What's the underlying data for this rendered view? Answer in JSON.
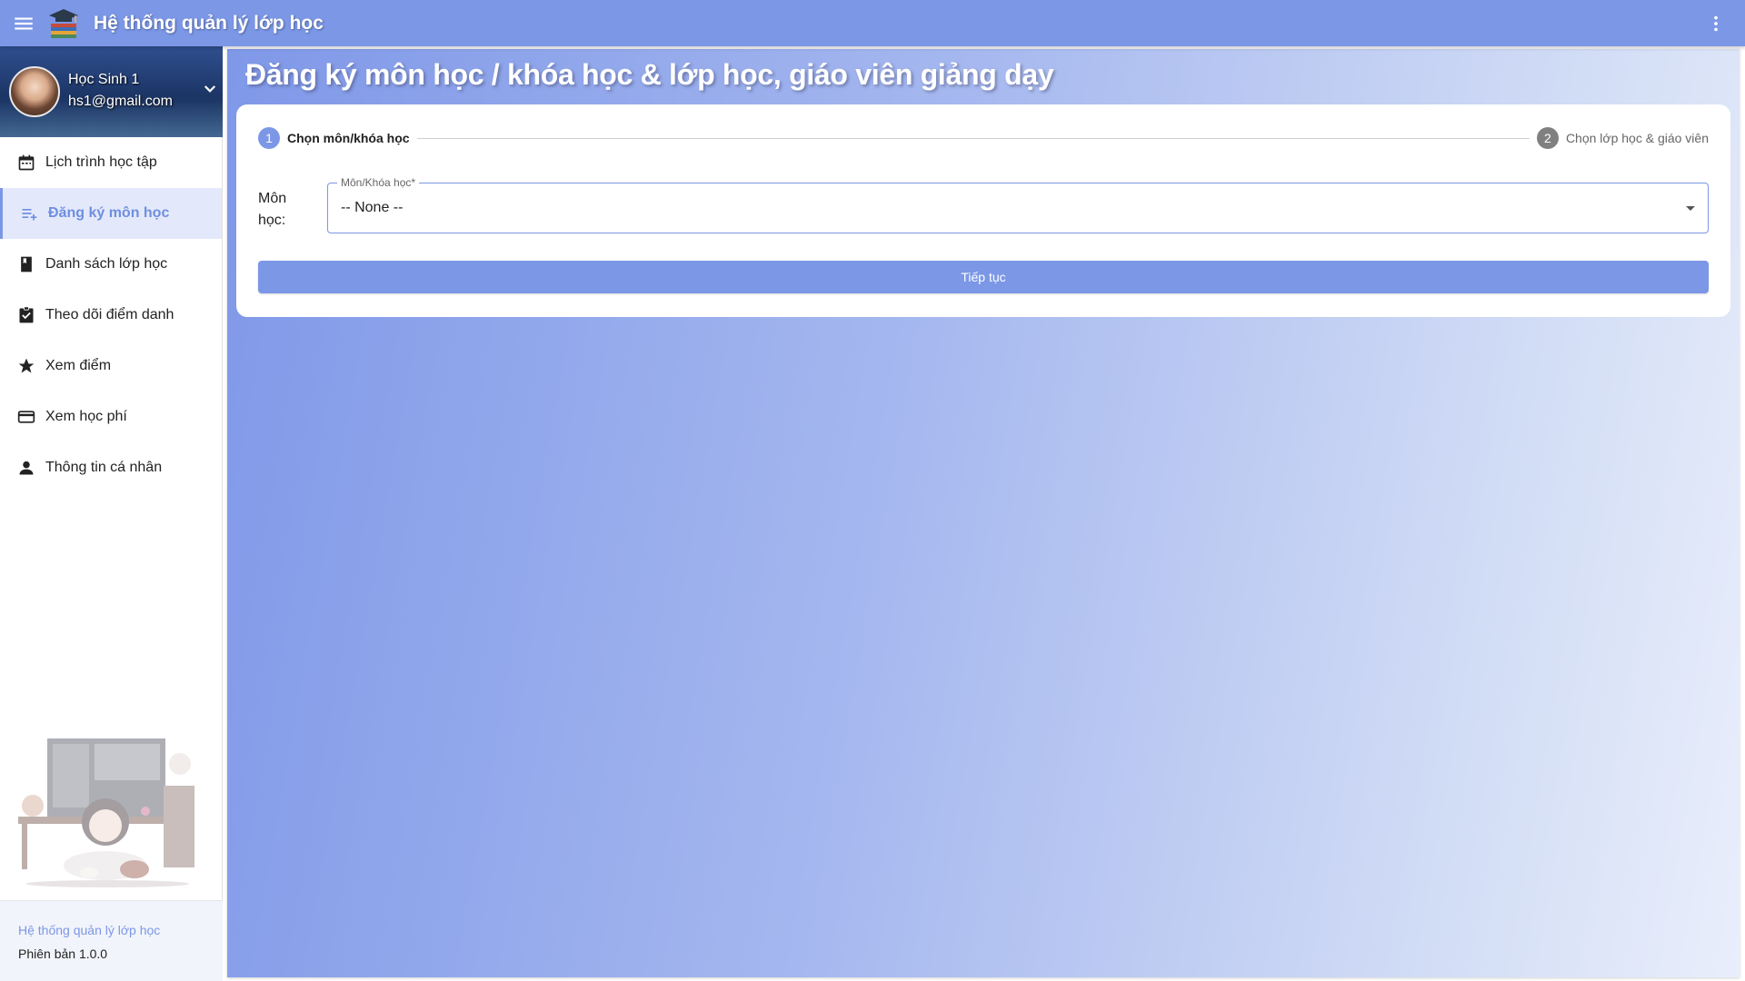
{
  "app": {
    "title": "Hệ thống quản lý lớp học",
    "accent_color": "#7b97e6"
  },
  "user": {
    "name": "Học Sinh 1",
    "email": "hs1@gmail.com"
  },
  "sidebar": {
    "items": [
      {
        "label": "Lịch trình học tập",
        "icon": "calendar-icon",
        "active": false
      },
      {
        "label": "Đăng ký môn học",
        "icon": "playlist-add-icon",
        "active": true
      },
      {
        "label": "Danh sách lớp học",
        "icon": "book-icon",
        "active": false
      },
      {
        "label": "Theo dõi điểm danh",
        "icon": "assignment-check-icon",
        "active": false
      },
      {
        "label": "Xem điểm",
        "icon": "star-icon",
        "active": false
      },
      {
        "label": "Xem học phí",
        "icon": "credit-card-icon",
        "active": false
      },
      {
        "label": "Thông tin cá nhân",
        "icon": "person-icon",
        "active": false
      }
    ],
    "footer": {
      "title": "Hệ thống quản lý lớp học",
      "version": "Phiên bản 1.0.0"
    }
  },
  "main": {
    "page_title": "Đăng ký môn học / khóa học & lớp học, giáo viên giảng dạy",
    "stepper": [
      {
        "number": "1",
        "label": "Chọn môn/khóa học",
        "active": true
      },
      {
        "number": "2",
        "label": "Chọn lớp học & giáo viên",
        "active": false
      }
    ],
    "course_field": {
      "label": "Môn học:",
      "legend": "Môn/Khóa học*",
      "value": "-- None --"
    },
    "continue_label": "Tiếp tục"
  }
}
